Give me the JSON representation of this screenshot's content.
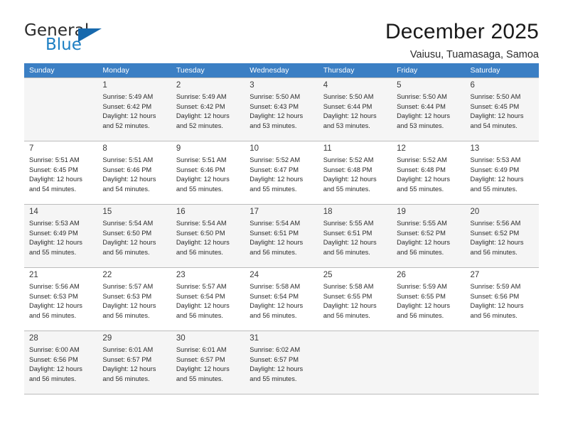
{
  "brand": {
    "name_line1": "General",
    "name_line2": "Blue",
    "triangle_color": "#1769ad",
    "blue_text_color": "#1d7fc3"
  },
  "header": {
    "title": "December 2025",
    "subtitle": "Vaiusu, Tuamasaga, Samoa"
  },
  "theme": {
    "header_bg": "#3b7fc4",
    "shaded_row_bg": "#f5f5f5",
    "grid_line": "#bcbcbc"
  },
  "labels": {
    "sunrise_prefix": "Sunrise:",
    "sunset_prefix": "Sunset:",
    "daylight_prefix": "Daylight:"
  },
  "columns": [
    "Sunday",
    "Monday",
    "Tuesday",
    "Wednesday",
    "Thursday",
    "Friday",
    "Saturday"
  ],
  "weeks": [
    [
      {
        "day": "",
        "lines": []
      },
      {
        "day": "1",
        "lines": [
          "Sunrise: 5:49 AM",
          "Sunset: 6:42 PM",
          "Daylight: 12 hours",
          "and 52 minutes."
        ]
      },
      {
        "day": "2",
        "lines": [
          "Sunrise: 5:49 AM",
          "Sunset: 6:42 PM",
          "Daylight: 12 hours",
          "and 52 minutes."
        ]
      },
      {
        "day": "3",
        "lines": [
          "Sunrise: 5:50 AM",
          "Sunset: 6:43 PM",
          "Daylight: 12 hours",
          "and 53 minutes."
        ]
      },
      {
        "day": "4",
        "lines": [
          "Sunrise: 5:50 AM",
          "Sunset: 6:44 PM",
          "Daylight: 12 hours",
          "and 53 minutes."
        ]
      },
      {
        "day": "5",
        "lines": [
          "Sunrise: 5:50 AM",
          "Sunset: 6:44 PM",
          "Daylight: 12 hours",
          "and 53 minutes."
        ]
      },
      {
        "day": "6",
        "lines": [
          "Sunrise: 5:50 AM",
          "Sunset: 6:45 PM",
          "Daylight: 12 hours",
          "and 54 minutes."
        ]
      }
    ],
    [
      {
        "day": "7",
        "lines": [
          "Sunrise: 5:51 AM",
          "Sunset: 6:45 PM",
          "Daylight: 12 hours",
          "and 54 minutes."
        ]
      },
      {
        "day": "8",
        "lines": [
          "Sunrise: 5:51 AM",
          "Sunset: 6:46 PM",
          "Daylight: 12 hours",
          "and 54 minutes."
        ]
      },
      {
        "day": "9",
        "lines": [
          "Sunrise: 5:51 AM",
          "Sunset: 6:46 PM",
          "Daylight: 12 hours",
          "and 55 minutes."
        ]
      },
      {
        "day": "10",
        "lines": [
          "Sunrise: 5:52 AM",
          "Sunset: 6:47 PM",
          "Daylight: 12 hours",
          "and 55 minutes."
        ]
      },
      {
        "day": "11",
        "lines": [
          "Sunrise: 5:52 AM",
          "Sunset: 6:48 PM",
          "Daylight: 12 hours",
          "and 55 minutes."
        ]
      },
      {
        "day": "12",
        "lines": [
          "Sunrise: 5:52 AM",
          "Sunset: 6:48 PM",
          "Daylight: 12 hours",
          "and 55 minutes."
        ]
      },
      {
        "day": "13",
        "lines": [
          "Sunrise: 5:53 AM",
          "Sunset: 6:49 PM",
          "Daylight: 12 hours",
          "and 55 minutes."
        ]
      }
    ],
    [
      {
        "day": "14",
        "lines": [
          "Sunrise: 5:53 AM",
          "Sunset: 6:49 PM",
          "Daylight: 12 hours",
          "and 55 minutes."
        ]
      },
      {
        "day": "15",
        "lines": [
          "Sunrise: 5:54 AM",
          "Sunset: 6:50 PM",
          "Daylight: 12 hours",
          "and 56 minutes."
        ]
      },
      {
        "day": "16",
        "lines": [
          "Sunrise: 5:54 AM",
          "Sunset: 6:50 PM",
          "Daylight: 12 hours",
          "and 56 minutes."
        ]
      },
      {
        "day": "17",
        "lines": [
          "Sunrise: 5:54 AM",
          "Sunset: 6:51 PM",
          "Daylight: 12 hours",
          "and 56 minutes."
        ]
      },
      {
        "day": "18",
        "lines": [
          "Sunrise: 5:55 AM",
          "Sunset: 6:51 PM",
          "Daylight: 12 hours",
          "and 56 minutes."
        ]
      },
      {
        "day": "19",
        "lines": [
          "Sunrise: 5:55 AM",
          "Sunset: 6:52 PM",
          "Daylight: 12 hours",
          "and 56 minutes."
        ]
      },
      {
        "day": "20",
        "lines": [
          "Sunrise: 5:56 AM",
          "Sunset: 6:52 PM",
          "Daylight: 12 hours",
          "and 56 minutes."
        ]
      }
    ],
    [
      {
        "day": "21",
        "lines": [
          "Sunrise: 5:56 AM",
          "Sunset: 6:53 PM",
          "Daylight: 12 hours",
          "and 56 minutes."
        ]
      },
      {
        "day": "22",
        "lines": [
          "Sunrise: 5:57 AM",
          "Sunset: 6:53 PM",
          "Daylight: 12 hours",
          "and 56 minutes."
        ]
      },
      {
        "day": "23",
        "lines": [
          "Sunrise: 5:57 AM",
          "Sunset: 6:54 PM",
          "Daylight: 12 hours",
          "and 56 minutes."
        ]
      },
      {
        "day": "24",
        "lines": [
          "Sunrise: 5:58 AM",
          "Sunset: 6:54 PM",
          "Daylight: 12 hours",
          "and 56 minutes."
        ]
      },
      {
        "day": "25",
        "lines": [
          "Sunrise: 5:58 AM",
          "Sunset: 6:55 PM",
          "Daylight: 12 hours",
          "and 56 minutes."
        ]
      },
      {
        "day": "26",
        "lines": [
          "Sunrise: 5:59 AM",
          "Sunset: 6:55 PM",
          "Daylight: 12 hours",
          "and 56 minutes."
        ]
      },
      {
        "day": "27",
        "lines": [
          "Sunrise: 5:59 AM",
          "Sunset: 6:56 PM",
          "Daylight: 12 hours",
          "and 56 minutes."
        ]
      }
    ],
    [
      {
        "day": "28",
        "lines": [
          "Sunrise: 6:00 AM",
          "Sunset: 6:56 PM",
          "Daylight: 12 hours",
          "and 56 minutes."
        ]
      },
      {
        "day": "29",
        "lines": [
          "Sunrise: 6:01 AM",
          "Sunset: 6:57 PM",
          "Daylight: 12 hours",
          "and 56 minutes."
        ]
      },
      {
        "day": "30",
        "lines": [
          "Sunrise: 6:01 AM",
          "Sunset: 6:57 PM",
          "Daylight: 12 hours",
          "and 55 minutes."
        ]
      },
      {
        "day": "31",
        "lines": [
          "Sunrise: 6:02 AM",
          "Sunset: 6:57 PM",
          "Daylight: 12 hours",
          "and 55 minutes."
        ]
      },
      {
        "day": "",
        "lines": []
      },
      {
        "day": "",
        "lines": []
      },
      {
        "day": "",
        "lines": []
      }
    ]
  ]
}
